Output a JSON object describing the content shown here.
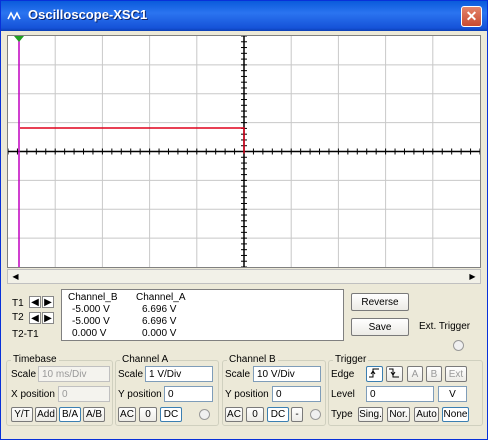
{
  "window": {
    "title": "Oscilloscope-XSC1"
  },
  "icons": {
    "app": "oscilloscope-icon",
    "close": "close-icon"
  },
  "colors": {
    "trace_a": "#e0001b",
    "marker": "#c000c0",
    "grid": "#c8c8c8",
    "trigger": "#20a020"
  },
  "readout": {
    "rows": [
      "T1",
      "T2",
      "T2-T1"
    ],
    "chB_header": "Channel_B",
    "chA_header": "Channel_A",
    "chB_values": [
      "-5.000 V",
      "-5.000 V",
      "0.000 V"
    ],
    "chA_values": [
      "6.696 V",
      "6.696 V",
      "0.000 V"
    ]
  },
  "buttons": {
    "reverse": "Reverse",
    "save": "Save",
    "ext_trigger": "Ext. Trigger"
  },
  "timebase": {
    "title": "Timebase",
    "scale_label": "Scale",
    "scale_value": "10 ms/Div",
    "xpos_label": "X position",
    "xpos_value": "0",
    "modes": [
      "Y/T",
      "Add",
      "B/A",
      "A/B"
    ]
  },
  "channel_a": {
    "title": "Channel A",
    "scale_label": "Scale",
    "scale_value": "1  V/Div",
    "ypos_label": "Y position",
    "ypos_value": "0",
    "coupling": [
      "AC",
      "0",
      "DC"
    ]
  },
  "channel_b": {
    "title": "Channel B",
    "scale_label": "Scale",
    "scale_value": "10  V/Div",
    "ypos_label": "Y position",
    "ypos_value": "0",
    "coupling": [
      "AC",
      "0",
      "DC",
      "-"
    ]
  },
  "trigger": {
    "title": "Trigger",
    "edge_label": "Edge",
    "edge_buttons": [
      "A",
      "B",
      "Ext"
    ],
    "level_label": "Level",
    "level_value": "0",
    "level_unit": "V",
    "type_label": "Type",
    "types": [
      "Sing.",
      "Nor.",
      "Auto",
      "None"
    ]
  }
}
